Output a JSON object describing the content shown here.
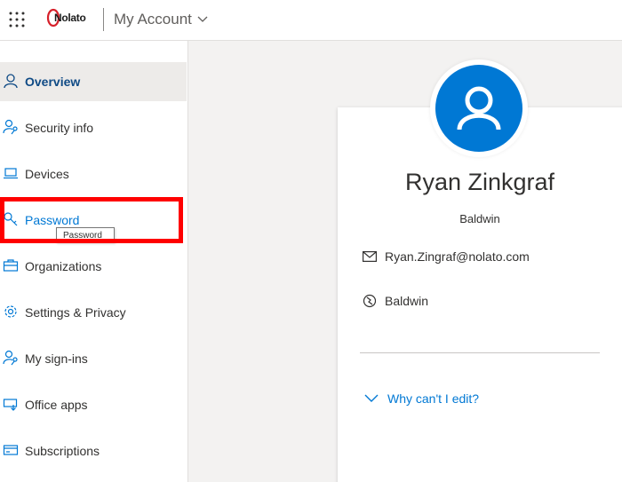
{
  "header": {
    "logo_text": "Nolato",
    "app_title": "My Account"
  },
  "sidebar": {
    "items": [
      {
        "label": "Overview",
        "icon": "person-icon"
      },
      {
        "label": "Security info",
        "icon": "person-key-icon"
      },
      {
        "label": "Devices",
        "icon": "laptop-icon"
      },
      {
        "label": "Password",
        "icon": "key-icon"
      },
      {
        "label": "Organizations",
        "icon": "briefcase-icon"
      },
      {
        "label": "Settings & Privacy",
        "icon": "gear-icon"
      },
      {
        "label": "My sign-ins",
        "icon": "person-key-icon"
      },
      {
        "label": "Office apps",
        "icon": "download-icon"
      },
      {
        "label": "Subscriptions",
        "icon": "card-icon"
      }
    ],
    "selected": "Overview",
    "tooltip": "Password"
  },
  "profile": {
    "name": "Ryan Zinkgraf",
    "subtitle": "Baldwin",
    "email": "Ryan.Zingraf@nolato.com",
    "location": "Baldwin",
    "edit_link": "Why can't I edit?"
  },
  "colors": {
    "accent": "#0078d4",
    "highlight": "#ff0000",
    "selected_bg": "#edebe9"
  }
}
